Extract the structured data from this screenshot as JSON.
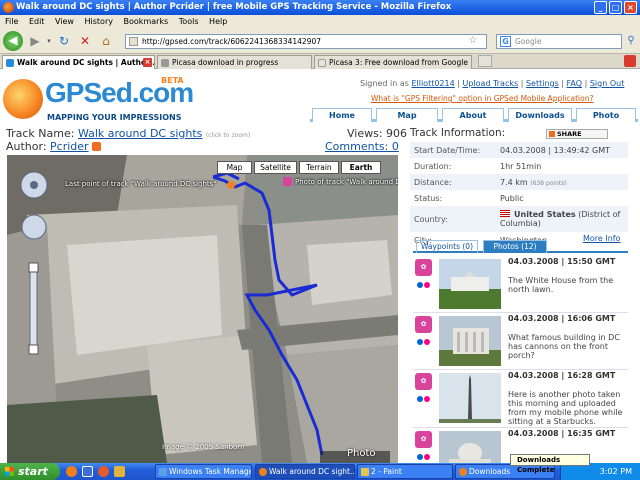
{
  "window": {
    "title": "Walk around DC sights | Author Pcrider | free Mobile GPS Tracking Service - Mozilla Firefox"
  },
  "menu": [
    "File",
    "Edit",
    "View",
    "History",
    "Bookmarks",
    "Tools",
    "Help"
  ],
  "nav": {
    "url": "http://gpsed.com/track/6062241368334142907",
    "search_placeholder": "Google"
  },
  "tabs": [
    {
      "label": "Walk around DC sights | Author ..."
    },
    {
      "label": "Picasa download in progress"
    },
    {
      "label": "Picasa 3: Free download from Google"
    }
  ],
  "site": {
    "logo_text": "GPSed.com",
    "beta": "BETA",
    "tagline": "MAPPING YOUR IMPRESSIONS",
    "signed_prefix": "Signed in as",
    "user": "Elliott0214",
    "links": [
      "Upload Tracks",
      "Settings",
      "FAQ",
      "Sign Out"
    ],
    "faq_link": "What is \"GPS Filtering\" option in GPSed Mobile Application?",
    "nav": [
      "Home",
      "Map",
      "About",
      "Downloads",
      "Photo"
    ]
  },
  "track": {
    "name_label": "Track Name:",
    "name": "Walk around DC sights",
    "zoom_hint": "(click to zoom)",
    "views_label": "Views:",
    "views": "906",
    "author_label": "Author:",
    "author": "Pcrider",
    "comments": "Comments: 0"
  },
  "map": {
    "types": [
      "Map",
      "Satellite",
      "Terrain",
      "Earth"
    ],
    "last_point": "Last point of track \"Walk around DC sights\"",
    "photo_label": "Photo of track \"Walk around DC",
    "credit": "Image © 2009 Sanborn",
    "overlay": "Photo"
  },
  "info": {
    "header": "Track Information:",
    "share": "SHARE",
    "rows": [
      {
        "k": "Start Date/Time:",
        "v": "04.03.2008 | 13:49:42 GMT"
      },
      {
        "k": "Duration:",
        "v": "1hr 51min"
      },
      {
        "k": "Distance:",
        "v": "7.4 km",
        "extra": "(638 points)"
      },
      {
        "k": "Status:",
        "v": "Public"
      },
      {
        "k": "Country:",
        "v": "United States",
        "extra": "(District of Columbia)"
      },
      {
        "k": "City:",
        "v": "Washington"
      }
    ],
    "more": "More Info"
  },
  "photo_tabs": [
    "Waypoints (0)",
    "Photos (12)"
  ],
  "photos": [
    {
      "date": "04.03.2008 | 15:50 GMT",
      "caption": "The White House from the north lawn."
    },
    {
      "date": "04.03.2008 | 16:06 GMT",
      "caption": "What famous building in DC has cannons on the front porch?"
    },
    {
      "date": "04.03.2008 | 16:28 GMT",
      "caption": "Here is another photo taken this morning and uploaded from my mobile phone while sitting at a Starbucks."
    },
    {
      "date": "04.03.2008 | 16:35 GMT",
      "caption": ""
    }
  ],
  "taskbar": {
    "start": "start",
    "items": [
      "Windows Task Manager",
      "Walk around DC sight...",
      "2 - Paint",
      "Downloads"
    ],
    "time": "3:02 PM",
    "toast": "Downloads Complete"
  }
}
